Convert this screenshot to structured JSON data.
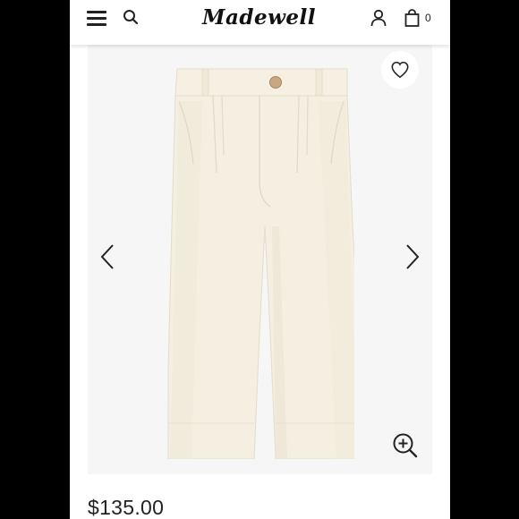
{
  "header": {
    "brand": "Madewell",
    "bag_count": "0",
    "icons": [
      "menu-icon",
      "search-icon",
      "account-icon",
      "shopping-bag-icon"
    ]
  },
  "product": {
    "price": "$135.00",
    "icons": [
      "heart-icon",
      "chevron-left-icon",
      "chevron-right-icon",
      "zoom-in-icon"
    ]
  },
  "colors": {
    "background": "#000000",
    "page": "#ffffff",
    "image_backdrop": "#f6f6f6",
    "garment": "#f3eee0",
    "text": "#222222"
  }
}
